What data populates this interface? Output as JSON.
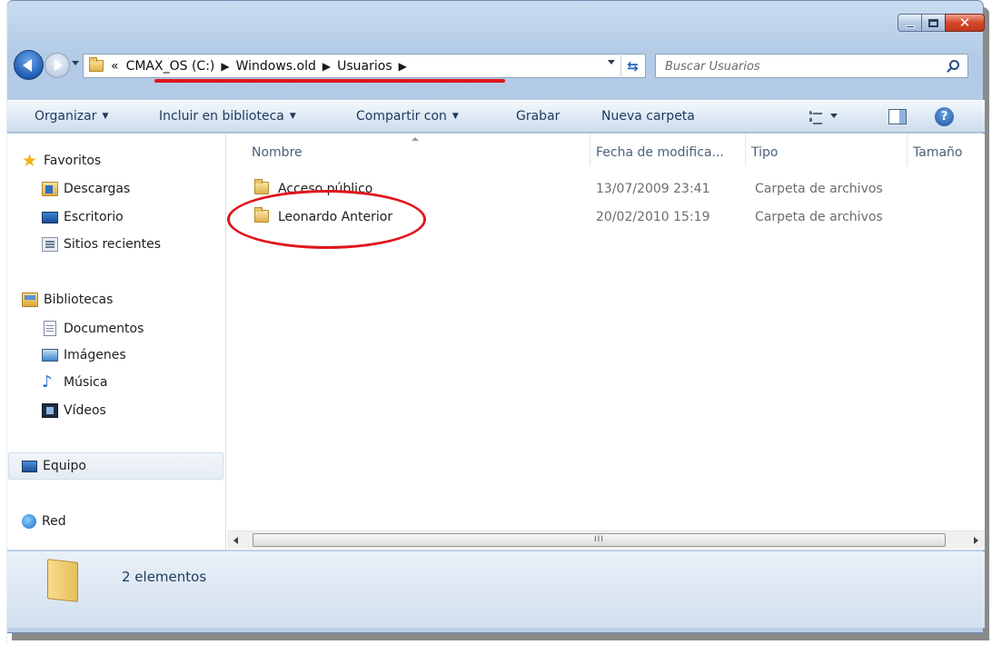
{
  "window": {
    "caption_buttons": [
      "minimize",
      "maximize",
      "close"
    ]
  },
  "navigation": {
    "back_icon": "arrow-left",
    "forward_icon": "arrow-right",
    "breadcrumb": {
      "overflow": "«",
      "items": [
        "CMAX_OS (C:)",
        "Windows.old",
        "Usuarios"
      ]
    },
    "search_placeholder": "Buscar Usuarios"
  },
  "toolbar": {
    "organize": "Organizar",
    "include_library": "Incluir en biblioteca",
    "share_with": "Compartir con",
    "burn": "Grabar",
    "new_folder": "Nueva carpeta"
  },
  "nav_pane": {
    "favorites": {
      "label": "Favoritos",
      "items": [
        "Descargas",
        "Escritorio",
        "Sitios recientes"
      ]
    },
    "libraries": {
      "label": "Bibliotecas",
      "items": [
        "Documentos",
        "Imágenes",
        "Música",
        "Vídeos"
      ]
    },
    "computer": "Equipo",
    "network": "Red"
  },
  "file_list": {
    "columns": [
      "Nombre",
      "Fecha de modifica...",
      "Tipo",
      "Tamaño"
    ],
    "rows": [
      {
        "name": "Acceso público",
        "date": "13/07/2009 23:41",
        "type": "Carpeta de archivos"
      },
      {
        "name": "Leonardo Anterior",
        "date": "20/02/2010 15:19",
        "type": "Carpeta de archivos"
      }
    ],
    "scrollbar_grip": "III"
  },
  "status": {
    "item_count": "2 elementos"
  },
  "colors": {
    "annotation_red": "#e0141c",
    "toolbar_text": "#1e395b",
    "window_frame": "#b9d0ea"
  }
}
